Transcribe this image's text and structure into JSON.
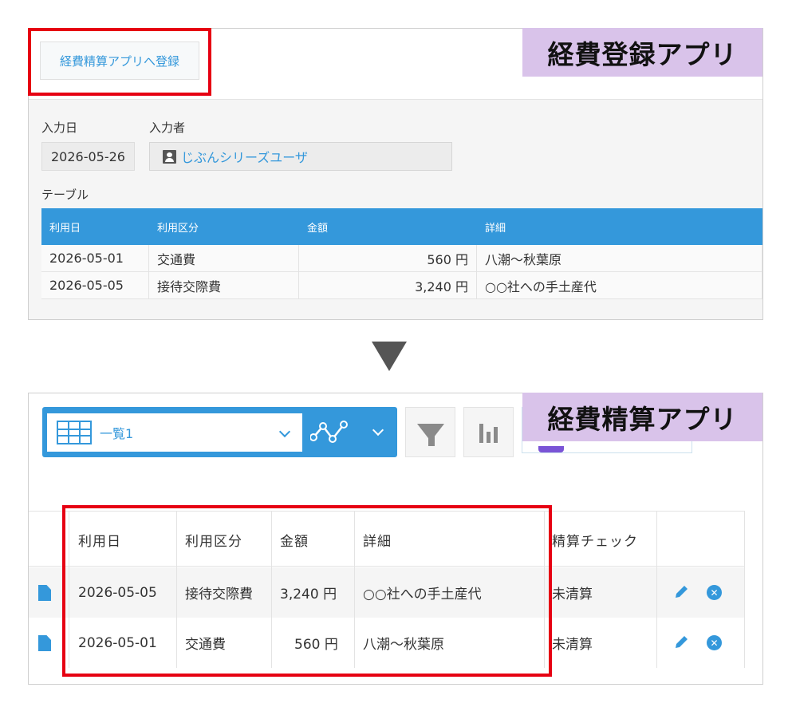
{
  "top_app": {
    "label": "経費登録アプリ",
    "register_button": "経費精算アプリへ登録",
    "fields": {
      "date_label": "入力日",
      "date_value": "2026-05-26",
      "user_label": "入力者",
      "user_value": "じぶんシリーズユーザ",
      "table_label": "テーブル"
    },
    "table": {
      "headers": [
        "利用日",
        "利用区分",
        "金額",
        "詳細"
      ],
      "rows": [
        {
          "date": "2026-05-01",
          "category": "交通費",
          "amount": "560 円",
          "detail": "八潮～秋葉原"
        },
        {
          "date": "2026-05-05",
          "category": "接待交際費",
          "amount": "3,240 円",
          "detail": "○○社への手土産代"
        }
      ]
    }
  },
  "bottom_app": {
    "label": "経費精算アプリ",
    "view_name": "一覧1",
    "list": {
      "headers": [
        "利用日",
        "利用区分",
        "金額",
        "詳細",
        "精算チェック"
      ],
      "rows": [
        {
          "date": "2026-05-05",
          "category": "接待交際費",
          "amount": "3,240 円",
          "detail": "○○社への手土産代",
          "status": "未清算"
        },
        {
          "date": "2026-05-01",
          "category": "交通費",
          "amount": "560 円",
          "detail": "八潮～秋葉原",
          "status": "未清算"
        }
      ]
    }
  },
  "colors": {
    "accent": "#3498db",
    "highlight": "#e60012",
    "label_bg": "#d9c3ea"
  },
  "icons": [
    "user-icon",
    "grid-icon",
    "chevron-down-icon",
    "graph-icon",
    "filter-icon",
    "bar-chart-icon",
    "document-icon",
    "pencil-icon",
    "close-icon",
    "down-arrow-icon"
  ]
}
